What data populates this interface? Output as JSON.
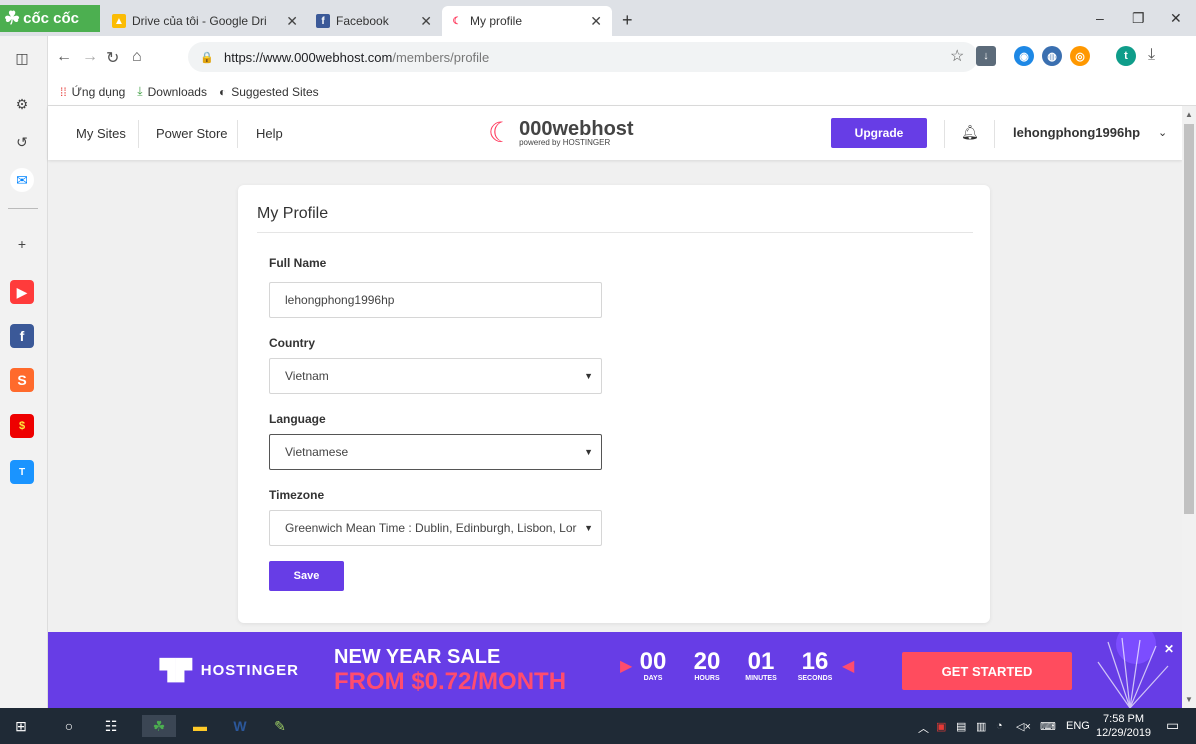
{
  "browser": {
    "brand": "cốc cốc",
    "tabs": [
      {
        "label": "Drive của tôi - Google Dri",
        "icon": "google-drive-icon"
      },
      {
        "label": "Facebook",
        "icon": "facebook-icon"
      },
      {
        "label": "My profile",
        "icon": "000webhost-icon"
      }
    ],
    "url_host": "https://www.000webhost.com",
    "url_path": "/members/profile",
    "bookmarks": [
      {
        "label": "Ứng dụng",
        "icon": "apps-grid-icon"
      },
      {
        "label": "Downloads",
        "icon": "download-icon"
      },
      {
        "label": "Suggested Sites",
        "icon": "globe-icon"
      }
    ]
  },
  "site": {
    "nav": [
      "My Sites",
      "Power Store",
      "Help"
    ],
    "brand_name": "000webhost",
    "brand_sub": "powered by HOSTINGER",
    "upgrade_label": "Upgrade",
    "username": "lehongphong1996hp"
  },
  "profile": {
    "title": "My Profile",
    "full_name_label": "Full Name",
    "full_name_value": "lehongphong1996hp",
    "country_label": "Country",
    "country_value": "Vietnam",
    "language_label": "Language",
    "language_value": "Vietnamese",
    "timezone_label": "Timezone",
    "timezone_value": "Greenwich Mean Time : Dublin, Edinburgh, Lisbon, Lor",
    "save_label": "Save"
  },
  "promo": {
    "brand": "HOSTINGER",
    "headline": "NEW YEAR SALE",
    "price": "FROM $0.72/MONTH",
    "countdown": [
      {
        "value": "00",
        "unit": "DAYS"
      },
      {
        "value": "20",
        "unit": "HOURS"
      },
      {
        "value": "01",
        "unit": "MINUTES"
      },
      {
        "value": "16",
        "unit": "SECONDS"
      }
    ],
    "cta": "GET STARTED"
  },
  "taskbar": {
    "language": "ENG",
    "time": "7:58 PM",
    "date": "12/29/2019"
  },
  "colors": {
    "accent": "#673de6",
    "cta": "#ff4c5e",
    "taskbar": "#1f2a36"
  }
}
